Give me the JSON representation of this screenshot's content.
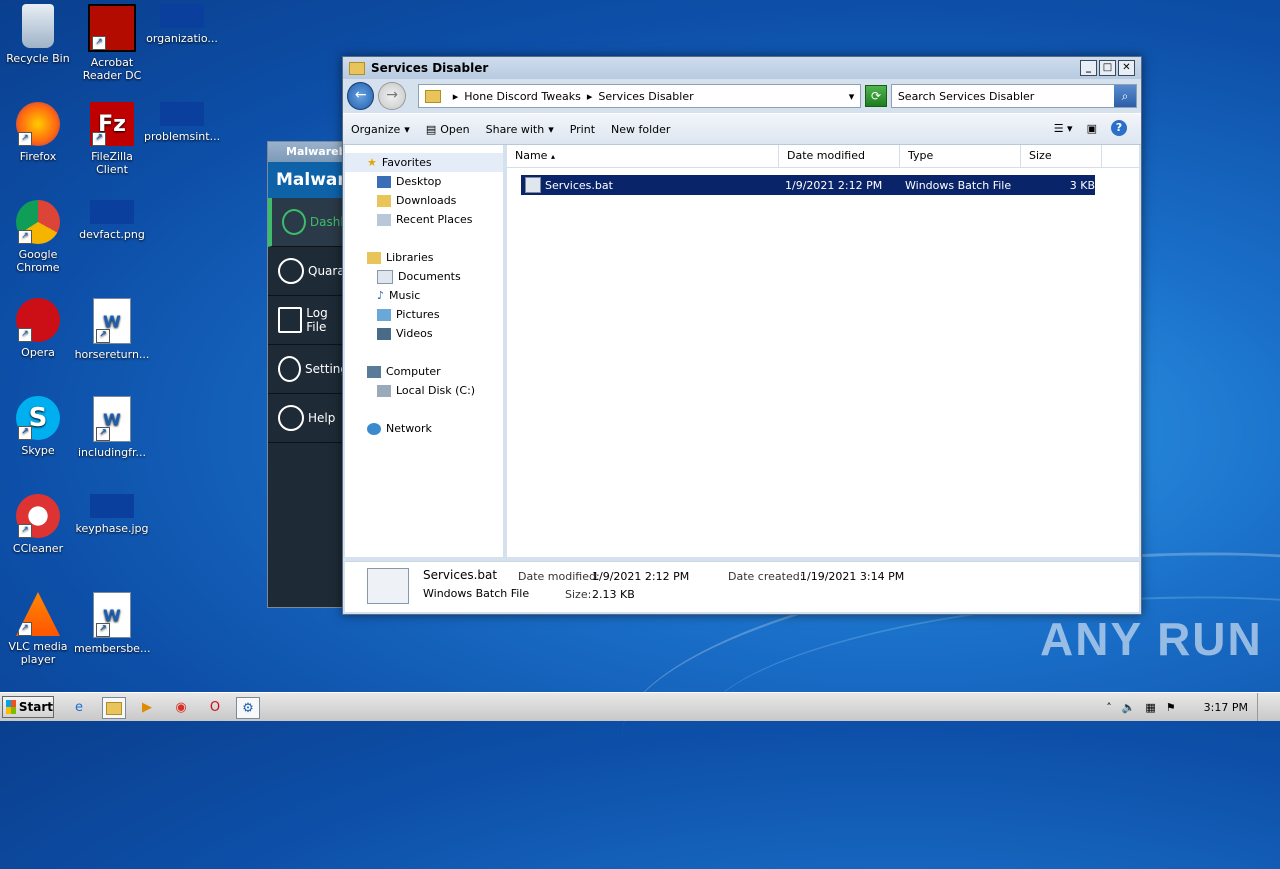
{
  "desktop": {
    "icons": [
      {
        "label": "Recycle Bin",
        "icon": "recycle-bin-icon"
      },
      {
        "label": "Acrobat Reader DC",
        "icon": "acrobat-icon"
      },
      {
        "label": "organizatio...",
        "icon": "file-icon"
      },
      {
        "label": "Firefox",
        "icon": "firefox-icon"
      },
      {
        "label": "FileZilla Client",
        "icon": "filezilla-icon"
      },
      {
        "label": "problemsint...",
        "icon": "file-icon"
      },
      {
        "label": "Google Chrome",
        "icon": "chrome-icon"
      },
      {
        "label": "devfact.png",
        "icon": "image-icon"
      },
      {
        "label": "Opera",
        "icon": "opera-icon"
      },
      {
        "label": "horsereturn...",
        "icon": "word-doc-icon"
      },
      {
        "label": "Skype",
        "icon": "skype-icon"
      },
      {
        "label": "includingfr...",
        "icon": "word-doc-icon"
      },
      {
        "label": "CCleaner",
        "icon": "ccleaner-icon"
      },
      {
        "label": "keyphase.jpg",
        "icon": "image-icon"
      },
      {
        "label": "VLC media player",
        "icon": "vlc-icon"
      },
      {
        "label": "membersbe...",
        "icon": "word-doc-icon"
      }
    ]
  },
  "malwarebytes": {
    "title": "Malwareb",
    "logo": "Malware",
    "items": [
      "Dashb",
      "Quara",
      "Log File",
      "Setting",
      "Help"
    ]
  },
  "explorer": {
    "title": "Services Disabler",
    "breadcrumb": [
      "Hone Discord Tweaks",
      "Services Disabler"
    ],
    "search_placeholder": "Search Services Disabler",
    "toolbar": {
      "organize": "Organize",
      "open": "Open",
      "share_with": "Share with",
      "print": "Print",
      "new_folder": "New folder"
    },
    "nav": {
      "favorites": "Favorites",
      "desktop": "Desktop",
      "downloads": "Downloads",
      "recent": "Recent Places",
      "libraries": "Libraries",
      "documents": "Documents",
      "music": "Music",
      "pictures": "Pictures",
      "videos": "Videos",
      "computer": "Computer",
      "local_disk": "Local Disk (C:)",
      "network": "Network"
    },
    "columns": {
      "name": "Name",
      "date": "Date modified",
      "type": "Type",
      "size": "Size"
    },
    "file": {
      "name": "Services.bat",
      "date": "1/9/2021 2:12 PM",
      "type": "Windows Batch File",
      "size": "3 KB"
    },
    "details": {
      "name": "Services.bat",
      "type": "Windows Batch File",
      "date_modified_label": "Date modified:",
      "date_modified": "1/9/2021 2:12 PM",
      "size_label": "Size:",
      "size": "2.13 KB",
      "date_created_label": "Date created:",
      "date_created": "1/19/2021 3:14 PM"
    }
  },
  "taskbar": {
    "start": "Start",
    "clock": "3:17 PM"
  },
  "watermark": "ANY RUN"
}
